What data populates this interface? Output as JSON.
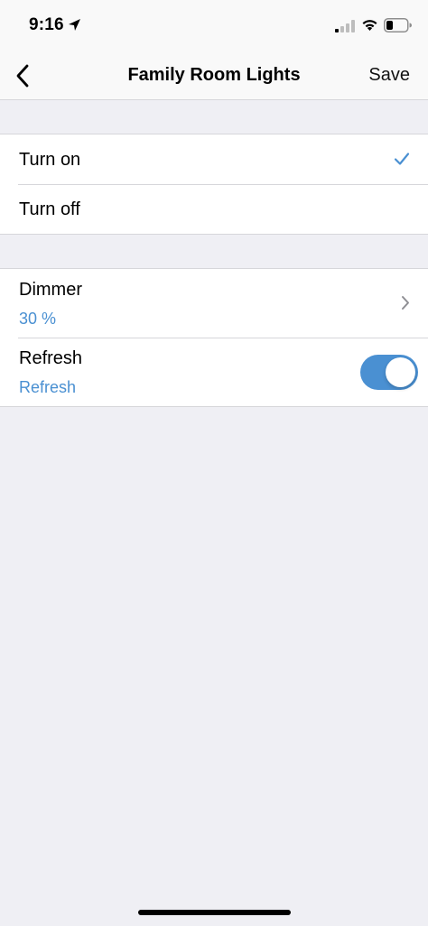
{
  "status_bar": {
    "time": "9:16",
    "location_icon": "location-arrow-icon",
    "signal_icon": "cellular-signal-icon",
    "wifi_icon": "wifi-icon",
    "battery_icon": "battery-icon"
  },
  "nav": {
    "back_icon": "chevron-left-icon",
    "title": "Family Room Lights",
    "save_label": "Save"
  },
  "power_group": {
    "items": [
      {
        "label": "Turn on",
        "selected": true,
        "icon": "checkmark-icon"
      },
      {
        "label": "Turn off",
        "selected": false
      }
    ]
  },
  "settings_group": {
    "dimmer": {
      "label": "Dimmer",
      "value": "30 %",
      "icon": "chevron-right-icon"
    },
    "refresh": {
      "label": "Refresh",
      "value": "Refresh",
      "enabled": true
    }
  },
  "colors": {
    "accent": "#4a90d2",
    "background": "#efeff4",
    "separator": "#d6d6da"
  }
}
